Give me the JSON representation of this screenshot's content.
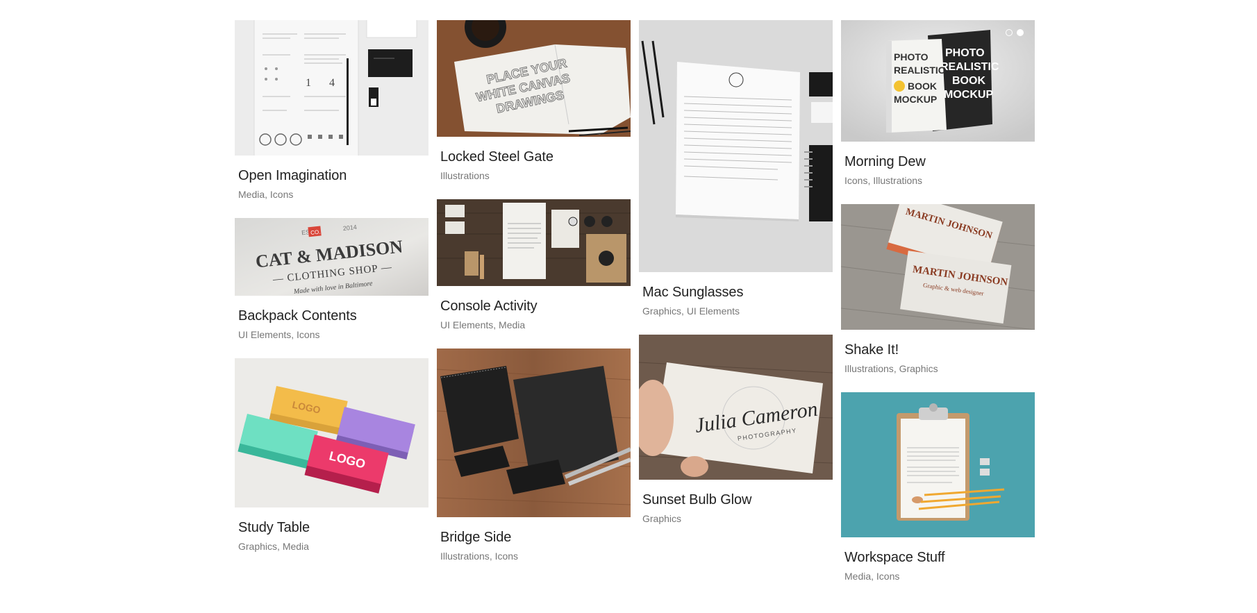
{
  "portfolio": {
    "columns": [
      [
        {
          "title": "Open Imagination",
          "cats": [
            "Media",
            "Icons"
          ]
        },
        {
          "title": "Backpack Contents",
          "cats": [
            "UI Elements",
            "Icons"
          ]
        },
        {
          "title": "Study Table",
          "cats": [
            "Graphics",
            "Media"
          ]
        }
      ],
      [
        {
          "title": "Locked Steel Gate",
          "cats": [
            "Illustrations"
          ]
        },
        {
          "title": "Console Activity",
          "cats": [
            "UI Elements",
            "Media"
          ]
        },
        {
          "title": "Bridge Side",
          "cats": [
            "Illustrations",
            "Icons"
          ]
        }
      ],
      [
        {
          "title": "Mac Sunglasses",
          "cats": [
            "Graphics",
            "UI Elements"
          ]
        },
        {
          "title": "Sunset Bulb Glow",
          "cats": [
            "Graphics"
          ]
        }
      ],
      [
        {
          "title": "Morning Dew",
          "cats": [
            "Icons",
            "Illustrations"
          ]
        },
        {
          "title": "Shake It!",
          "cats": [
            "Illustrations",
            "Graphics"
          ]
        },
        {
          "title": "Workspace Stuff",
          "cats": [
            "Media",
            "Icons"
          ]
        }
      ]
    ],
    "separator": ", "
  },
  "image_text": {
    "cat_madison": {
      "est": "EST.",
      "year": "2014",
      "badge": "CO.",
      "line1": "CAT & MADISON",
      "line2": "— CLOTHING SHOP —",
      "line3": "Made with love in Baltimore"
    },
    "sketch": {
      "line1": "PLACE YOUR",
      "line2": "WHITE CANVAS",
      "line3": "DRAWINGS"
    },
    "logo_cards": {
      "logo1": "LOGO",
      "logo2": "LOGO"
    },
    "book": {
      "l1": "PHOTO",
      "l2": "REALISTIC",
      "l3": "BOOK",
      "l4": "MOCKUP",
      "dark1": "PHOTO",
      "dark2": "REALISTIC",
      "dark3": "BOOK",
      "dark4": "MOCKUP"
    },
    "martin": {
      "name": "MARTIN JOHNSON",
      "role": "Graphic & web designer"
    },
    "julia": {
      "name": "Julia Cameron",
      "sub": "PHOTOGRAPHY"
    },
    "resume": {
      "n1": "1",
      "n2": "4"
    }
  },
  "slider": {
    "active_index": 1,
    "count": 2
  },
  "colors": {
    "title": "#222222",
    "category": "#777777",
    "teal_bg": "#4ca3ae",
    "wood": "#8a5a3c"
  }
}
